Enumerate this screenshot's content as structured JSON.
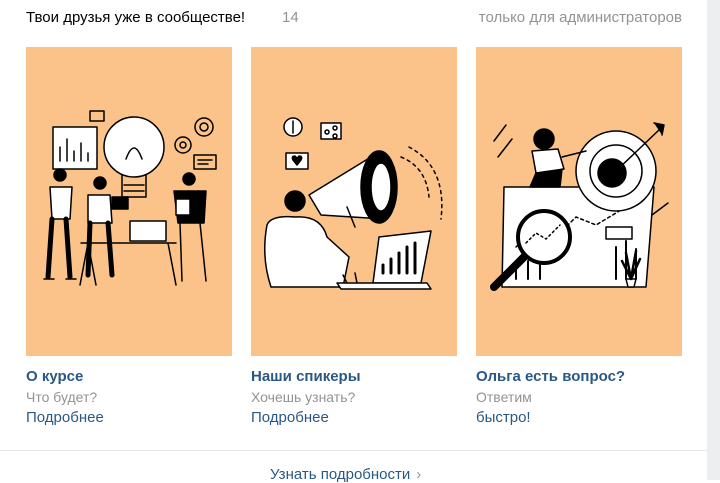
{
  "header": {
    "title": "Твои друзья уже в сообществе!",
    "count": "14",
    "admin_note": "только для администраторов"
  },
  "cards": [
    {
      "title": "О курсе",
      "subtitle": "Что будет?",
      "link": "Подробнее",
      "illustration": "team-ideas-illustration"
    },
    {
      "title": "Наши спикеры",
      "subtitle": "Хочешь узнать?",
      "link": "Подробнее",
      "illustration": "megaphone-illustration"
    },
    {
      "title": "Ольга есть вопрос?",
      "subtitle": "Ответим",
      "link": "быстро!",
      "illustration": "target-analytics-illustration"
    }
  ],
  "footer": {
    "link": "Узнать подробности",
    "chevron": "›"
  },
  "colors": {
    "card_bg": "#fbc389",
    "link": "#2a5885",
    "muted": "#939393"
  }
}
